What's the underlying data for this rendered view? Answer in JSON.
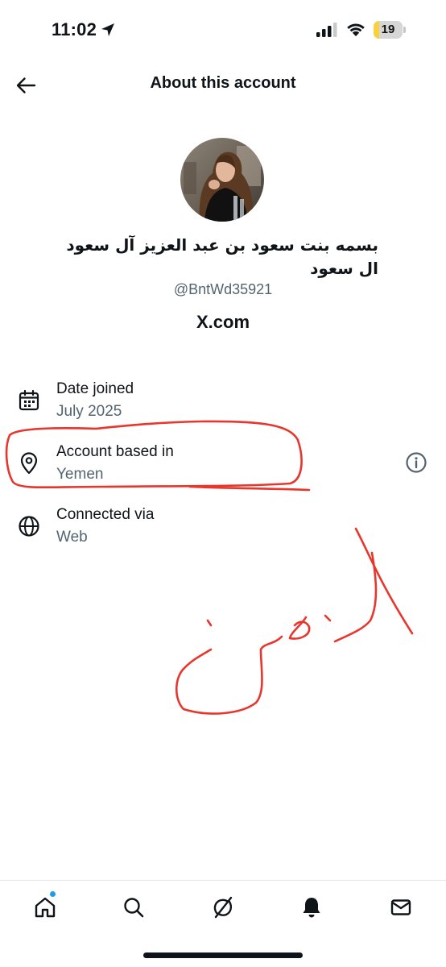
{
  "status_bar": {
    "time": "11:02",
    "battery_level": "19",
    "battery_fraction": 0.19,
    "accent_color": "#f7d23e"
  },
  "header": {
    "title": "About this account",
    "back_icon": "arrow-left-icon"
  },
  "profile": {
    "display_name": "بسمه بنت سعود بن عبد العزيز آل سعود ال سعود",
    "handle": "@BntWd35921",
    "source": "X.com",
    "avatar_icon": "avatar"
  },
  "info": [
    {
      "icon": "calendar-icon",
      "title": "Date joined",
      "value": "July 2025"
    },
    {
      "icon": "location-pin-icon",
      "title": "Account based in",
      "value": "Yemen"
    },
    {
      "icon": "globe-icon",
      "title": "Connected via",
      "value": "Web"
    }
  ],
  "info_button_icon": "info-icon",
  "annotation_color": "#e8362d",
  "bottom_nav": {
    "items": [
      "home-icon",
      "search-icon",
      "grok-icon",
      "bell-icon",
      "mail-icon"
    ],
    "notification_dot_color": "#1d9bf0"
  },
  "colors": {
    "primary_text": "#0f1419",
    "secondary_text": "#536471"
  }
}
